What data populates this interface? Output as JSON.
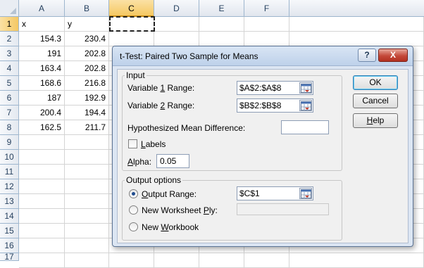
{
  "sheet": {
    "columns": [
      "A",
      "B",
      "C",
      "D",
      "E",
      "F"
    ],
    "rows": [
      "1",
      "2",
      "3",
      "4",
      "5",
      "6",
      "7",
      "8",
      "9",
      "10",
      "11",
      "12",
      "13",
      "14",
      "15",
      "16",
      "17"
    ],
    "cells": {
      "a1": "x",
      "b1": "y",
      "a2": "154.3",
      "b2": "230.4",
      "a3": "191",
      "b3": "202.8",
      "a4": "163.4",
      "b4": "202.8",
      "a5": "168.6",
      "b5": "216.8",
      "a6": "187",
      "b6": "192.9",
      "a7": "200.4",
      "b7": "194.4",
      "a8": "162.5",
      "b8": "211.7"
    }
  },
  "dialog": {
    "title": "t-Test: Paired Two Sample for Means",
    "help_glyph": "?",
    "close_glyph": "X",
    "input_group": "Input",
    "var1_label_pre": "Variable ",
    "var1_label_key": "1",
    "var1_label_post": " Range:",
    "var1_value": "$A$2:$A$8",
    "var2_label_pre": "Variable ",
    "var2_label_key": "2",
    "var2_label_post": " Range:",
    "var2_value": "$B$2:$B$8",
    "hyp_label": "Hypothesized Mean Difference:",
    "hyp_value": "",
    "labels_key": "L",
    "labels_rest": "abels",
    "alpha_key": "A",
    "alpha_rest": "lpha:",
    "alpha_value": "0.05",
    "output_group": "Output options",
    "out_range_key": "O",
    "out_range_rest": "utput Range:",
    "out_range_value": "$C$1",
    "new_ply_pre": "New Worksheet ",
    "new_ply_key": "P",
    "new_ply_post": "ly:",
    "new_wb_pre": "New ",
    "new_wb_key": "W",
    "new_wb_post": "orkbook",
    "ok": "OK",
    "cancel": "Cancel",
    "help_key": "H",
    "help_rest": "elp"
  }
}
